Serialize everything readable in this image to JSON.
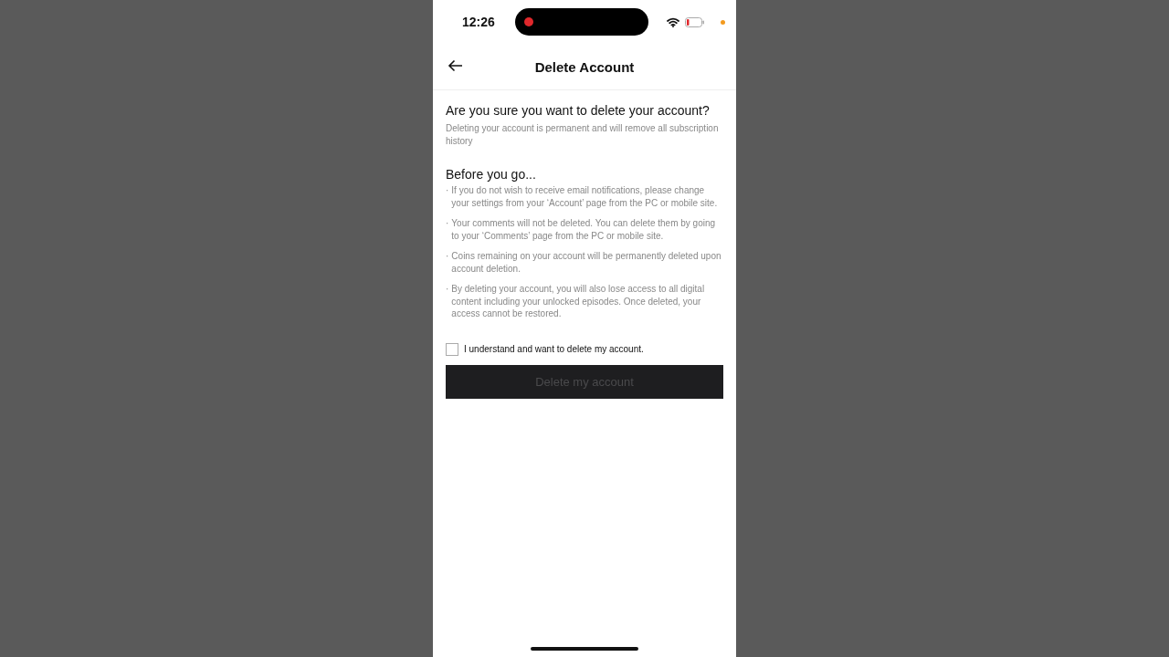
{
  "status_bar": {
    "time": "12:26"
  },
  "header": {
    "title": "Delete Account"
  },
  "intro": {
    "heading": "Are you sure you want to delete your account?",
    "text": "Deleting your account is permanent and will remove all subscription history"
  },
  "before_you_go": {
    "heading": "Before you go...",
    "bullet": "·",
    "items": [
      "If you do not wish to receive email notifications, please change your settings from your ‘Account’ page from the PC or mobile site.",
      "Your comments will not be deleted. You can delete them by going to your ‘Comments’ page from the PC or mobile site.",
      "Coins remaining on your account will be permanently deleted upon account deletion.",
      "By deleting your account, you will also lose access to all digital content including your unlocked episodes. Once deleted, your access cannot be restored."
    ]
  },
  "confirm": {
    "label": "I understand and want to delete my account.",
    "checked": false
  },
  "delete_button": {
    "label": "Delete my account",
    "disabled": true
  }
}
